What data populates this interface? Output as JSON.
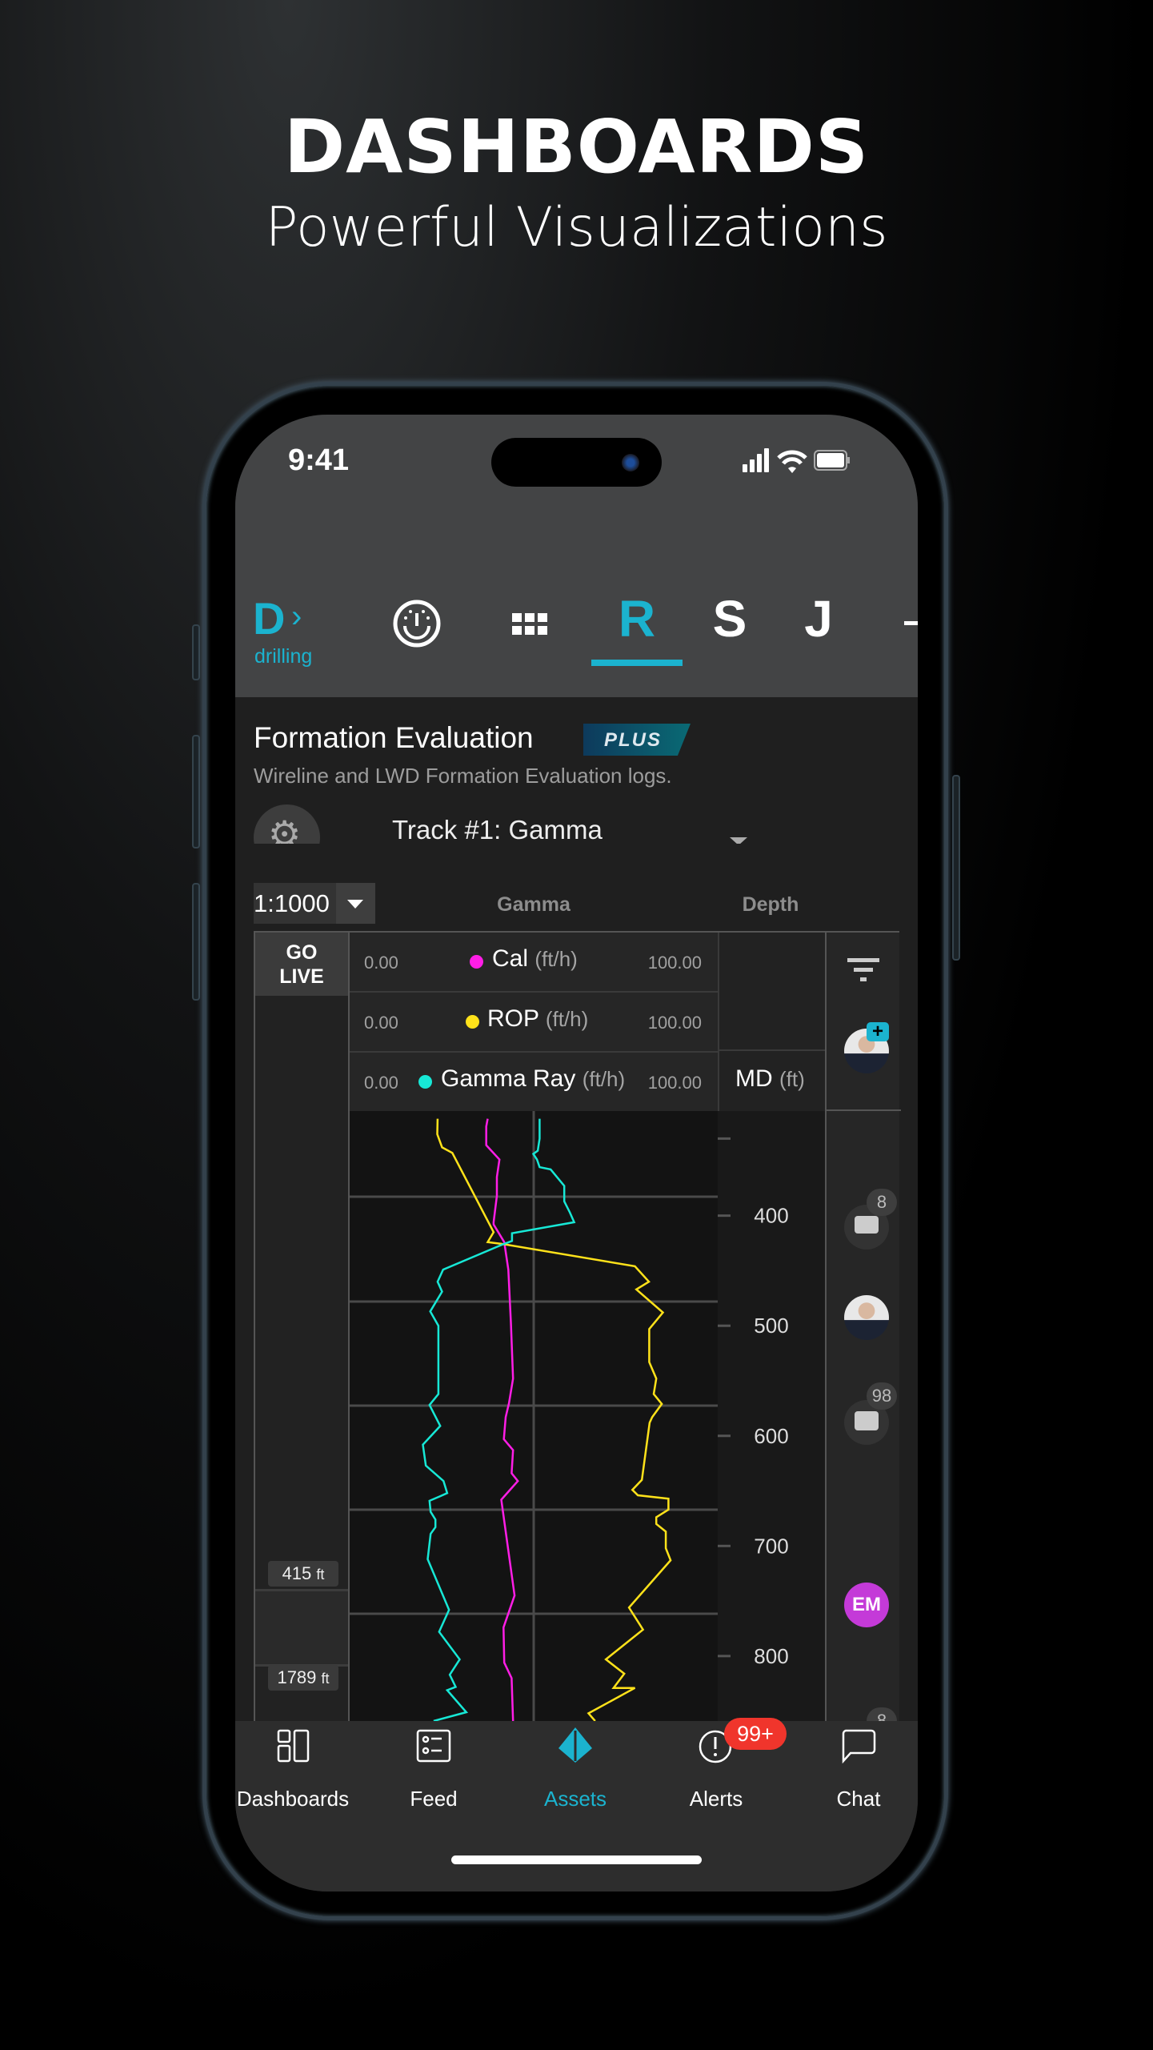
{
  "hero": {
    "title": "DASHBOARDS",
    "subtitle": "Powerful Visualizations"
  },
  "status_bar": {
    "time": "9:41",
    "icons": [
      "signal-icon",
      "wifi-icon",
      "battery-icon"
    ]
  },
  "top_nav": {
    "brand_letter": "D",
    "brand_label": "drilling",
    "items": [
      {
        "icon": "gauge-icon"
      },
      {
        "icon": "grid-icon"
      },
      {
        "label": "R",
        "active": true
      },
      {
        "label": "S"
      },
      {
        "label": "J"
      }
    ],
    "accent": "#1bb3cf"
  },
  "section": {
    "title": "Formation Evaluation",
    "badge": "PLUS",
    "subtitle": "Wireline and LWD Formation Evaluation logs.",
    "track_select": "Track #1: Gamma"
  },
  "toolbar": {
    "scale": "1:1000",
    "gamma_header": "Gamma",
    "depth_header": "Depth"
  },
  "log": {
    "go_live": "GO LIVE",
    "top_depth": "415",
    "bottom_depth": "1789",
    "depth_unit": "ft",
    "legend": [
      {
        "name": "Cal",
        "unit": "(ft/h)",
        "min": "0.00",
        "max": "100.00",
        "color": "#ff1ee6"
      },
      {
        "name": "ROP",
        "unit": "(ft/h)",
        "min": "0.00",
        "max": "100.00",
        "color": "#ffe21a"
      },
      {
        "name": "Gamma Ray",
        "unit": "(ft/h)",
        "min": "0.00",
        "max": "100.00",
        "color": "#17e8d6"
      }
    ],
    "depth_track": {
      "name": "MD",
      "unit": "(ft)"
    },
    "annotations": [
      {
        "type": "avatar-add"
      },
      {
        "type": "comment",
        "count": "8"
      },
      {
        "type": "avatar"
      },
      {
        "type": "comment",
        "count": "98"
      },
      {
        "type": "initials",
        "text": "EM",
        "color": "#c43ad8"
      },
      {
        "type": "comment",
        "count": "8"
      }
    ]
  },
  "chart_data": {
    "type": "line",
    "xlim": [
      0,
      100
    ],
    "ylim": [
      305,
      859
    ],
    "y_inverted": true,
    "ylabel": "MD (ft)",
    "yticks": [
      400,
      500,
      600,
      700,
      800
    ],
    "series": [
      {
        "name": "Cal",
        "color": "#ff1ee6",
        "points": [
          [
            37.5,
            312
          ],
          [
            37.1,
            319
          ],
          [
            37.1,
            336
          ],
          [
            40.7,
            349
          ],
          [
            40,
            365
          ],
          [
            40,
            382
          ],
          [
            39.1,
            406
          ],
          [
            39.1,
            408
          ],
          [
            42,
            424
          ],
          [
            43.1,
            449
          ],
          [
            43.8,
            497
          ],
          [
            44.4,
            548
          ],
          [
            43.3,
            570
          ],
          [
            42.4,
            583
          ],
          [
            41.9,
            603
          ],
          [
            44.4,
            613
          ],
          [
            44,
            634
          ],
          [
            45.7,
            641
          ],
          [
            41.2,
            658
          ],
          [
            44.8,
            745
          ],
          [
            41.8,
            774
          ],
          [
            42,
            806
          ],
          [
            44,
            820
          ],
          [
            44.4,
            859
          ]
        ]
      },
      {
        "name": "ROP",
        "color": "#ffe21a",
        "points": [
          [
            23.9,
            312
          ],
          [
            23.8,
            326
          ],
          [
            25.1,
            338
          ],
          [
            27.9,
            343
          ],
          [
            39.1,
            415
          ],
          [
            37.5,
            424
          ],
          [
            42,
            426
          ],
          [
            77.5,
            446
          ],
          [
            81.3,
            460
          ],
          [
            77.9,
            467
          ],
          [
            85.1,
            488
          ],
          [
            81.4,
            503
          ],
          [
            81.4,
            533
          ],
          [
            83.3,
            548
          ],
          [
            82.6,
            562
          ],
          [
            84.8,
            571
          ],
          [
            82.2,
            583
          ],
          [
            81.5,
            588
          ],
          [
            79.4,
            640
          ],
          [
            76.8,
            649
          ],
          [
            78.3,
            654
          ],
          [
            86.6,
            657
          ],
          [
            86.6,
            667
          ],
          [
            83.3,
            674
          ],
          [
            83.3,
            680
          ],
          [
            85.9,
            687
          ],
          [
            85.9,
            702
          ],
          [
            87.2,
            713
          ],
          [
            75.9,
            756
          ],
          [
            79.7,
            776
          ],
          [
            69.6,
            803
          ],
          [
            74.6,
            816
          ],
          [
            71.7,
            829
          ],
          [
            77.5,
            829
          ],
          [
            64.9,
            852
          ],
          [
            66.7,
            859
          ]
        ]
      },
      {
        "name": "Gamma Ray",
        "color": "#17e8d6",
        "points": [
          [
            51.6,
            312
          ],
          [
            51.6,
            330
          ],
          [
            51.1,
            341
          ],
          [
            49.9,
            344
          ],
          [
            50.9,
            349
          ],
          [
            51.6,
            356
          ],
          [
            54.6,
            358
          ],
          [
            58.3,
            373
          ],
          [
            58.3,
            387
          ],
          [
            59.8,
            397
          ],
          [
            61,
            406
          ],
          [
            44.1,
            416
          ],
          [
            44.1,
            423
          ],
          [
            41.7,
            426
          ],
          [
            25.4,
            449
          ],
          [
            23.9,
            460
          ],
          [
            25.1,
            469
          ],
          [
            21.9,
            487
          ],
          [
            24.1,
            500
          ],
          [
            24.1,
            562
          ],
          [
            21.7,
            572
          ],
          [
            24.6,
            591
          ],
          [
            19.9,
            608
          ],
          [
            20.7,
            627
          ],
          [
            25.5,
            641
          ],
          [
            26.5,
            652
          ],
          [
            24.5,
            655
          ],
          [
            21.7,
            659
          ],
          [
            22,
            669
          ],
          [
            23.3,
            676
          ],
          [
            23.3,
            683
          ],
          [
            22,
            689
          ],
          [
            21.2,
            712
          ],
          [
            27,
            758
          ],
          [
            24.3,
            778
          ],
          [
            29.9,
            803
          ],
          [
            27.2,
            817
          ],
          [
            28.8,
            828
          ],
          [
            26.5,
            831
          ],
          [
            31.7,
            851
          ],
          [
            22.8,
            859
          ]
        ]
      }
    ]
  },
  "tab_bar": {
    "items": [
      {
        "label": "Dashboards",
        "icon": "dashboards-icon"
      },
      {
        "label": "Feed",
        "icon": "feed-icon"
      },
      {
        "label": "Assets",
        "icon": "assets-icon",
        "active": true
      },
      {
        "label": "Alerts",
        "icon": "alert-icon",
        "badge": "99+"
      },
      {
        "label": "Chat",
        "icon": "chat-icon"
      }
    ],
    "badge_color": "#f0352c"
  }
}
